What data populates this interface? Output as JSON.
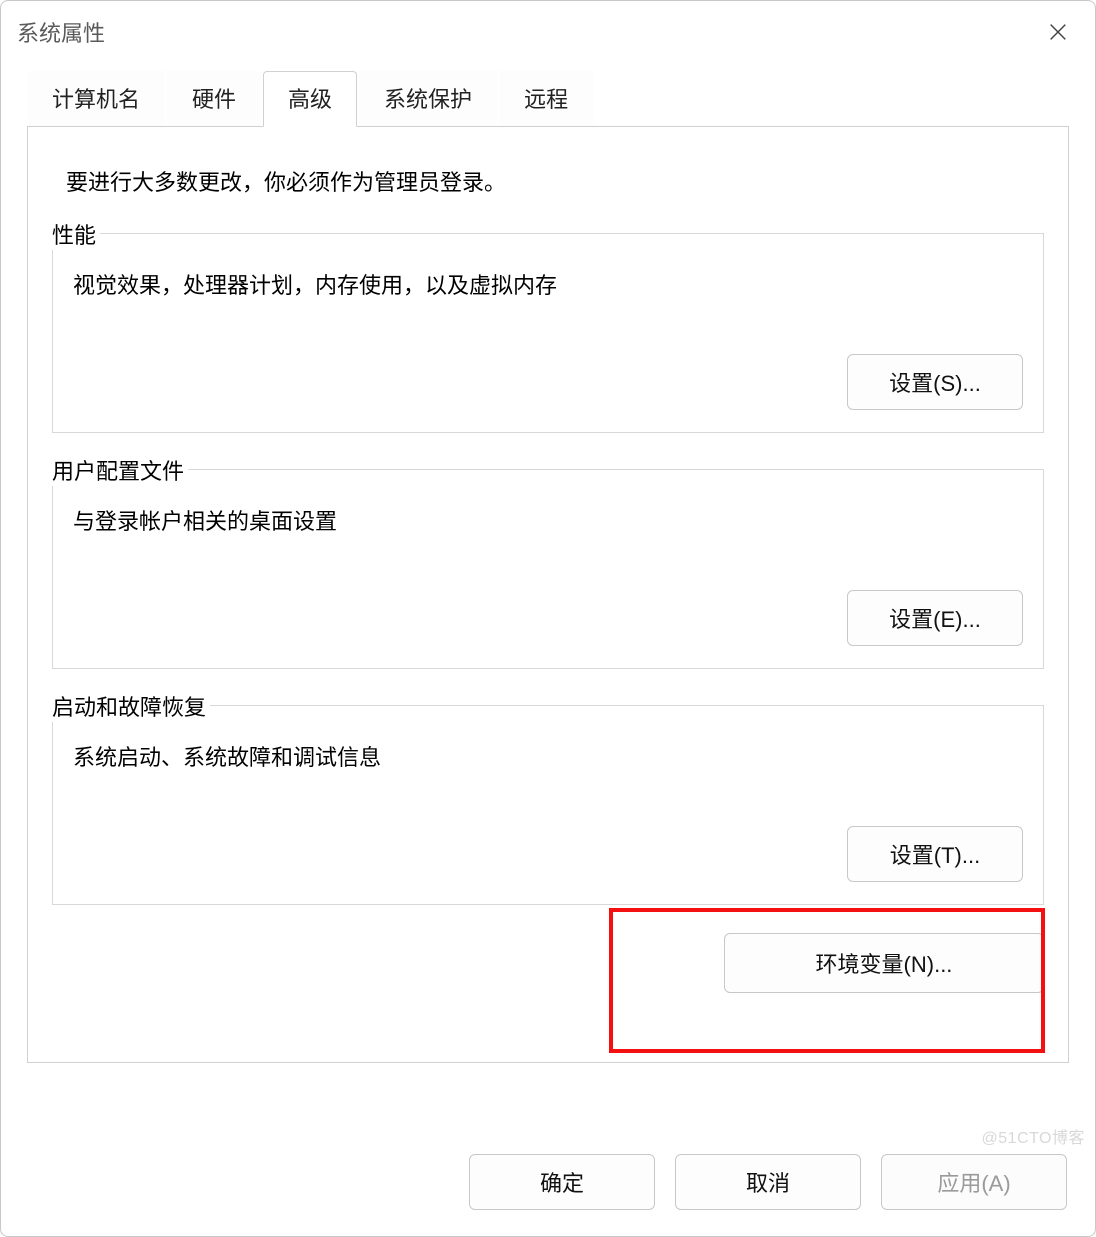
{
  "title": "系统属性",
  "tabs": {
    "computer_name": "计算机名",
    "hardware": "硬件",
    "advanced": "高级",
    "system_protection": "系统保护",
    "remote": "远程"
  },
  "intro": "要进行大多数更改，你必须作为管理员登录。",
  "groups": {
    "performance": {
      "label": "性能",
      "desc": "视觉效果，处理器计划，内存使用，以及虚拟内存",
      "button": "设置(S)..."
    },
    "user_profiles": {
      "label": "用户配置文件",
      "desc": "与登录帐户相关的桌面设置",
      "button": "设置(E)..."
    },
    "startup_recovery": {
      "label": "启动和故障恢复",
      "desc": "系统启动、系统故障和调试信息",
      "button": "设置(T)..."
    }
  },
  "env_button": "环境变量(N)...",
  "bottom": {
    "ok": "确定",
    "cancel": "取消",
    "apply": "应用(A)"
  },
  "watermark": "@51CTO博客"
}
